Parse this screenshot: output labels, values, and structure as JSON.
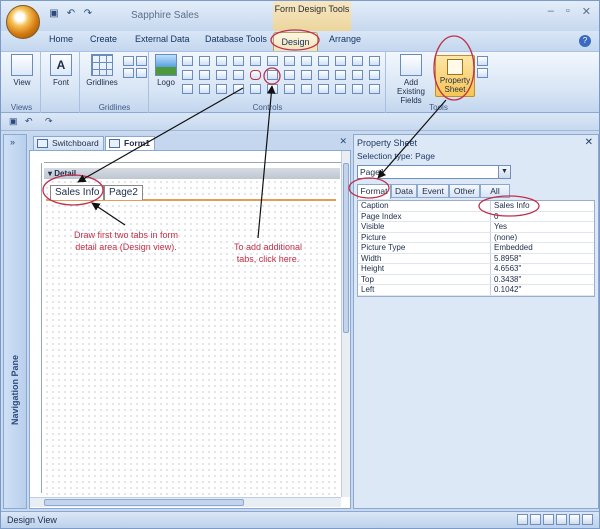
{
  "window": {
    "app_title": "Sapphire Sales",
    "context_title": "Form Design Tools"
  },
  "ribbon_tabs": [
    "Home",
    "Create",
    "External Data",
    "Database Tools",
    "Design",
    "Arrange"
  ],
  "ribbon": {
    "views_group": {
      "label": "Views",
      "view_button": "View"
    },
    "font_group": {
      "font_button": "Font"
    },
    "gridlines_group": {
      "label": "Gridlines",
      "gridlines_button": "Gridlines"
    },
    "controls_group": {
      "label": "Controls",
      "logo_button": "Logo"
    },
    "tools_group": {
      "label": "Tools",
      "add_existing_fields": "Add Existing Fields",
      "property_sheet": "Property Sheet"
    }
  },
  "navigation_pane": {
    "label": "Navigation Pane",
    "toggle": "»"
  },
  "document_tabs": [
    {
      "label": "Switchboard"
    },
    {
      "label": "Form1"
    }
  ],
  "form": {
    "detail_label": "Detail",
    "page_tabs": [
      "Sales Info",
      "Page2"
    ],
    "annotation_left": "Draw first two tabs in form detail area (Design view).",
    "annotation_right": "To add additional tabs, click here."
  },
  "property_sheet": {
    "title": "Property Sheet",
    "selection_type": "Selection type:  Page",
    "selected_object": "Page1",
    "tabs": [
      "Format",
      "Data",
      "Event",
      "Other",
      "All"
    ],
    "active_tab": "Format",
    "properties": [
      {
        "name": "Caption",
        "value": "Sales Info"
      },
      {
        "name": "Page Index",
        "value": "0"
      },
      {
        "name": "Visible",
        "value": "Yes"
      },
      {
        "name": "Picture",
        "value": "(none)"
      },
      {
        "name": "Picture Type",
        "value": "Embedded"
      },
      {
        "name": "Width",
        "value": "5.8958\""
      },
      {
        "name": "Height",
        "value": "4.6563\""
      },
      {
        "name": "Top",
        "value": "0.3438\""
      },
      {
        "name": "Left",
        "value": "0.1042\""
      }
    ]
  },
  "status_bar": {
    "text": "Design View"
  },
  "colors": {
    "annotation": "#c0304a",
    "accent": "#f7c654"
  }
}
